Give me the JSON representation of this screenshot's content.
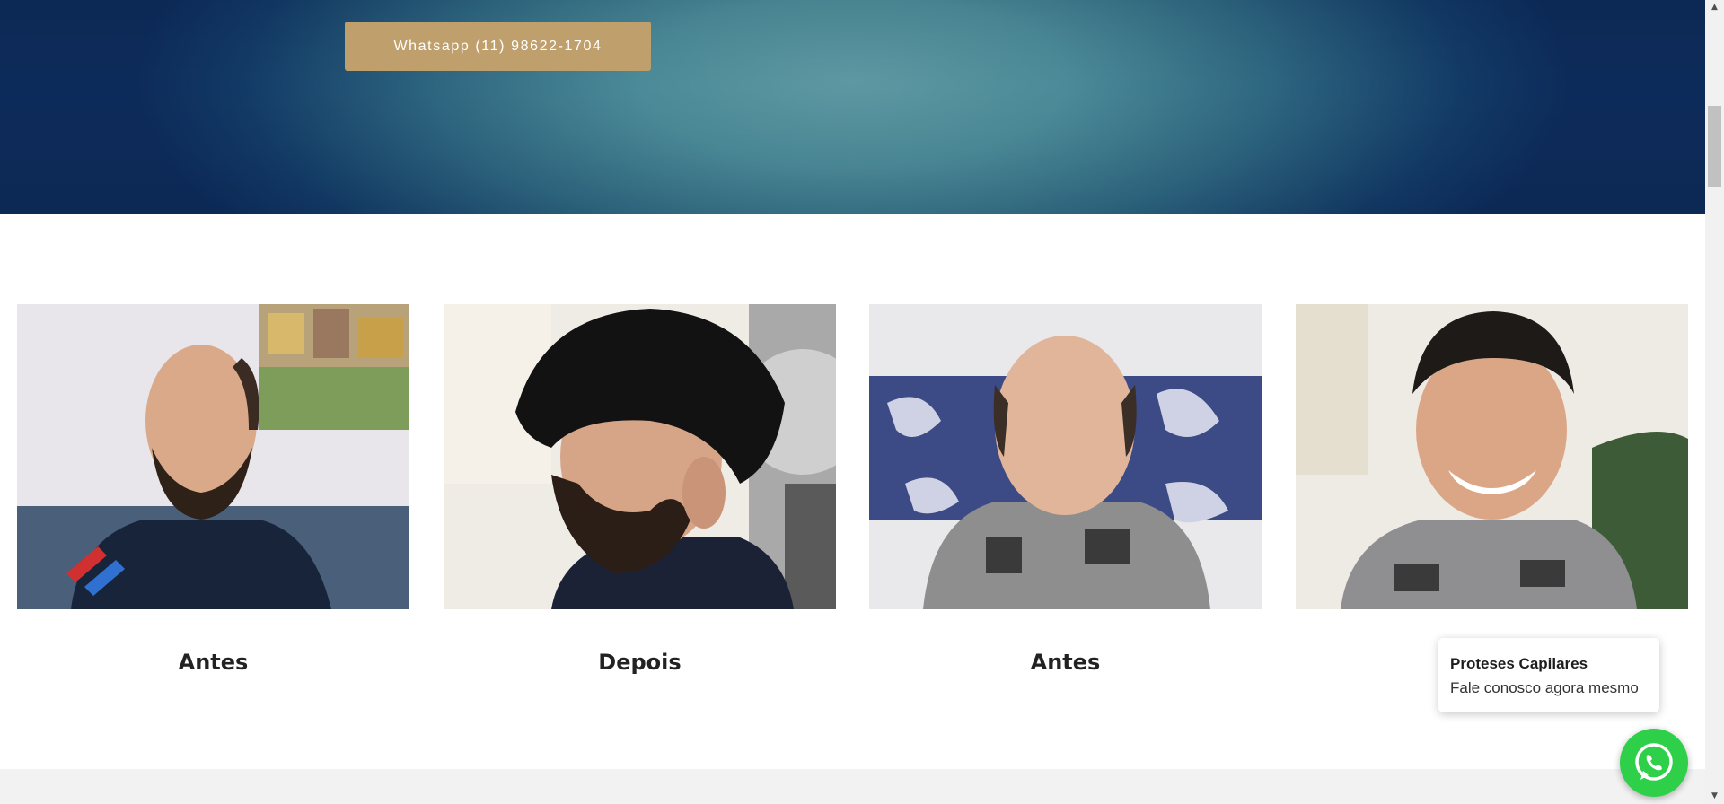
{
  "hero": {
    "whatsapp_button_label": "Whatsapp (11) 98622-1704"
  },
  "gallery": {
    "items": [
      {
        "caption": "Antes"
      },
      {
        "caption": "Depois"
      },
      {
        "caption": "Antes"
      },
      {
        "caption": ""
      }
    ]
  },
  "chat_widget": {
    "title": "Proteses Capilares",
    "message": "Fale conosco agora mesmo",
    "icon": "whatsapp-icon"
  },
  "colors": {
    "button_gold": "#bf9f6c",
    "whatsapp_green": "#2fd049",
    "hero_dark": "#0d2b5a",
    "hero_light": "#5e98a2"
  }
}
